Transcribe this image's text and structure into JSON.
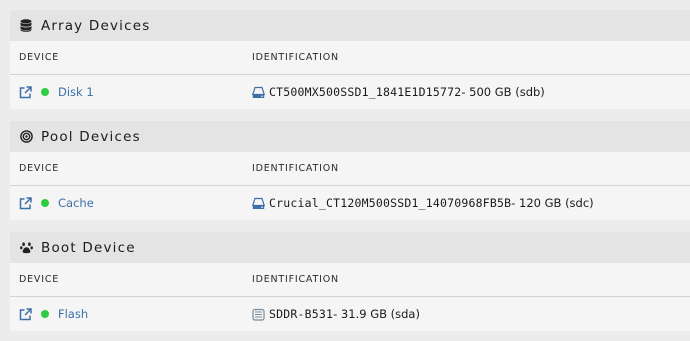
{
  "colors": {
    "accent": "#3d6fa8",
    "online": "#2ecc40"
  },
  "sections": [
    {
      "title": "Array Devices",
      "icon": "database-icon",
      "columns": {
        "device": "DEVICE",
        "identification": "IDENTIFICATION"
      },
      "device": {
        "name": "Disk 1",
        "status": "online",
        "id_name": "CT500MX500SSD1_1841E1D15772",
        "id_rest": " - 500 GB (sdb)",
        "icon": "hdd-icon"
      }
    },
    {
      "title": "Pool Devices",
      "icon": "bullseye-icon",
      "columns": {
        "device": "DEVICE",
        "identification": "IDENTIFICATION"
      },
      "device": {
        "name": "Cache",
        "status": "online",
        "id_name": "Crucial_CT120M500SSD1_14070968FB5B",
        "id_rest": " - 120 GB (sdc)",
        "icon": "hdd-icon"
      }
    },
    {
      "title": "Boot Device",
      "icon": "paw-icon",
      "columns": {
        "device": "DEVICE",
        "identification": "IDENTIFICATION"
      },
      "device": {
        "name": "Flash",
        "status": "online",
        "id_name": "SDDR-B531",
        "id_rest": " - 31.9 GB (sda)",
        "icon": "usb-drive-icon"
      }
    }
  ]
}
